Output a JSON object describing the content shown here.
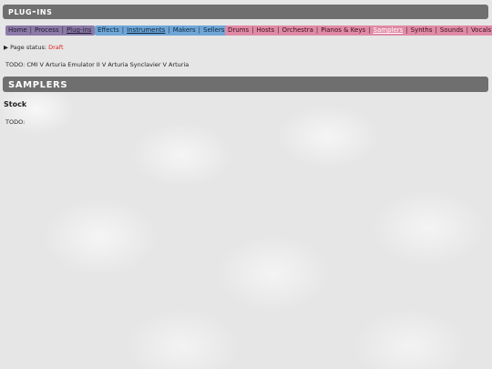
{
  "header": {
    "title": "Plug-ins"
  },
  "nav_main": [
    "Home",
    "Process",
    "Plug-ins"
  ],
  "nav_categories": [
    "Effects",
    "Instruments",
    "Makers",
    "Sellers"
  ],
  "nav_instruments": [
    "Drums",
    "Hosts",
    "Orchestra",
    "Pianos & Keys",
    "Samplers",
    "Synths",
    "Sounds",
    "Vocals"
  ],
  "status": {
    "prefix": "▶ Page status: ",
    "value": "Draft"
  },
  "todo_line": "TODO: CMI V Arturia Emulator II V Arturia Synclavier V Arturia",
  "section": {
    "title": "Samplers",
    "subheading": "Stock",
    "todo": "TODO:"
  }
}
